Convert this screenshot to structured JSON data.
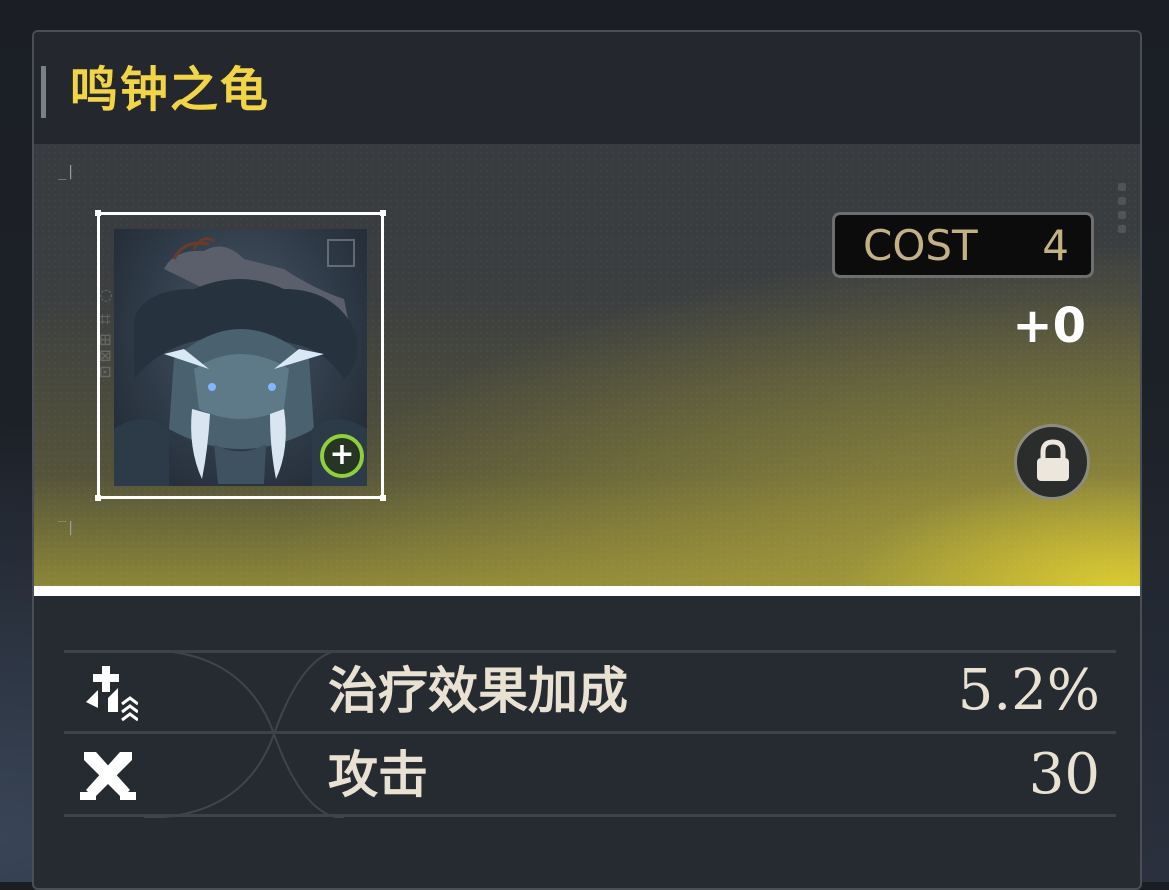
{
  "card": {
    "title": "鸣钟之龟",
    "cost_label": "COST",
    "cost_value": "4",
    "level": "+0",
    "add_badge_symbol": "+",
    "lock_icon": "lock-icon",
    "accent_color": "#f2d447"
  },
  "stats": [
    {
      "name": "治疗效果加成",
      "value": "5.2%",
      "icon": "healing-bonus-icon"
    },
    {
      "name": "攻击",
      "value": "30",
      "icon": "attack-icon"
    }
  ]
}
